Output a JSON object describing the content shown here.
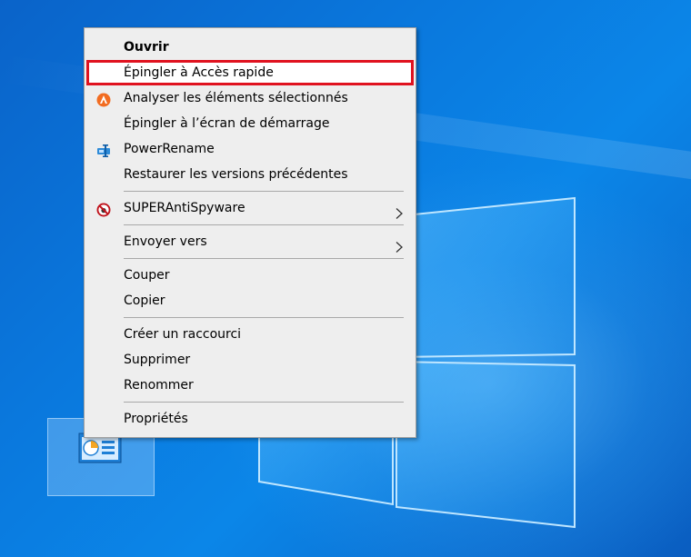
{
  "context_menu": {
    "groups": [
      [
        {
          "label": "Ouvrir",
          "bold": true
        },
        {
          "label": "Épingler à Accès rapide",
          "highlighted": true
        },
        {
          "label": "Analyser les éléments sélectionnés",
          "icon": "avast-icon"
        },
        {
          "label": "Épingler à l’écran de démarrage"
        },
        {
          "label": "PowerRename",
          "icon": "powerrename-icon"
        },
        {
          "label": "Restaurer les versions précédentes"
        }
      ],
      [
        {
          "label": "SUPERAntiSpyware",
          "icon": "superantispyware-icon",
          "submenu": true
        }
      ],
      [
        {
          "label": "Envoyer vers",
          "submenu": true
        }
      ],
      [
        {
          "label": "Couper"
        },
        {
          "label": "Copier"
        }
      ],
      [
        {
          "label": "Créer un raccourci"
        },
        {
          "label": "Supprimer"
        },
        {
          "label": "Renommer"
        }
      ],
      [
        {
          "label": "Propriétés"
        }
      ]
    ],
    "highlight_color": "#e0121f"
  },
  "desktop": {
    "selected_icon": "control-panel-icon",
    "background_color": "#0a78dd"
  }
}
